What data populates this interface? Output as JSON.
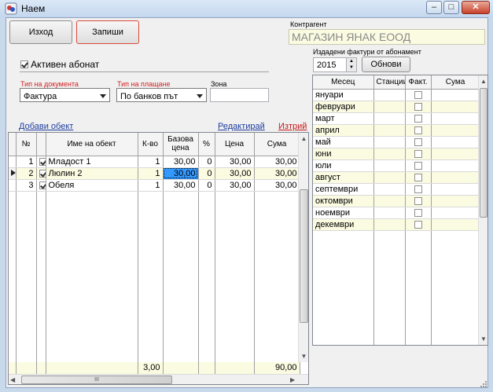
{
  "window": {
    "title": "Наем",
    "controls": {
      "minimize": "–",
      "maximize": "□",
      "close": "✕"
    }
  },
  "toolbar": {
    "exit_label": "Изход",
    "save_label": "Запиши"
  },
  "counterparty": {
    "label": "Контрагент",
    "value": "МАГАЗИН ЯНАК ЕООД"
  },
  "active_subscription": {
    "label": "Активен абонат",
    "checked": true
  },
  "document_type": {
    "label": "Тип на документа",
    "value": "Фактура"
  },
  "payment_type": {
    "label": "Тип на плащане",
    "value": "По банков път"
  },
  "zone": {
    "label": "Зона",
    "value": ""
  },
  "actions": {
    "add": "Добави обект",
    "edit": "Редактирай",
    "delete": "Изтрий"
  },
  "objects_table": {
    "columns": [
      "№",
      "Име на обект",
      "К-во",
      "Базова цена",
      "%",
      "Цена",
      "Сума"
    ],
    "rows": [
      {
        "no": "1",
        "checked": true,
        "name": "Младост 1",
        "qty": "1",
        "base_price": "30,00",
        "pct": "0",
        "price": "30,00",
        "sum": "30,00"
      },
      {
        "no": "2",
        "checked": true,
        "name": "Люлин 2",
        "qty": "1",
        "base_price": "30,00",
        "pct": "0",
        "price": "30,00",
        "sum": "30,00"
      },
      {
        "no": "3",
        "checked": true,
        "name": "Обеля",
        "qty": "1",
        "base_price": "30,00",
        "pct": "0",
        "price": "30,00",
        "sum": "30,00"
      }
    ],
    "totals": {
      "qty": "3,00",
      "sum": "90,00"
    },
    "hscroll_grip": "III"
  },
  "invoices": {
    "label": "Издадени фактури от абонамент",
    "year": "2015",
    "refresh_label": "Обнови",
    "columns": [
      "Месец",
      "Станции",
      "Факт.",
      "Сума"
    ],
    "months": [
      "януари",
      "февруари",
      "март",
      "април",
      "май",
      "юни",
      "юли",
      "август",
      "септември",
      "октомври",
      "ноември",
      "декември"
    ]
  },
  "colors": {
    "accent_red": "#d21f1f",
    "link_blue": "#1f3ea0",
    "row_highlight": "#fbfbe2",
    "selection": "#3399ff"
  }
}
